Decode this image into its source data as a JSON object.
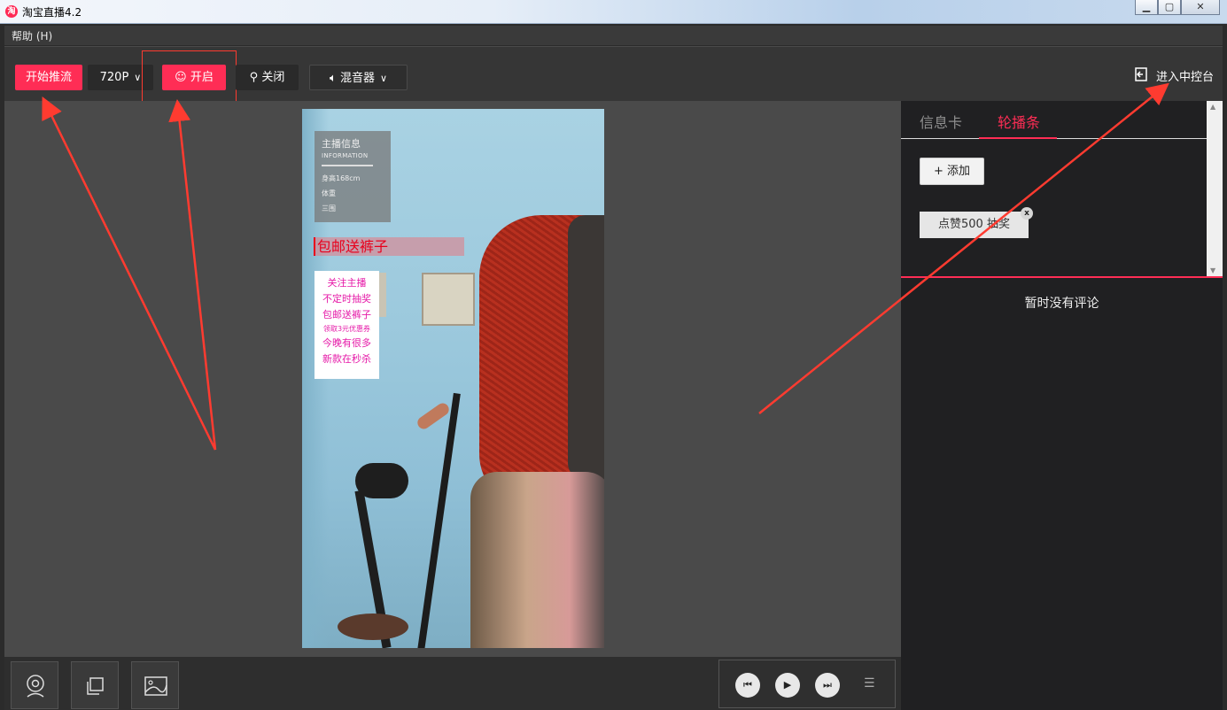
{
  "window": {
    "title": "淘宝直播4.2",
    "app_icon": "taobao-live-icon",
    "controls": [
      "minimize",
      "maximize",
      "close"
    ]
  },
  "menu": {
    "help": "帮助 (H)"
  },
  "toolbar": {
    "start_stream": "开始推流",
    "resolution": "720P",
    "beauty_on": "开启",
    "beauty_off": "关闭",
    "mixer": "混音器",
    "console": "进入中控台"
  },
  "preview": {
    "info_card": {
      "title": "主播信息",
      "subtitle": "INFORMATION",
      "height": "身高168cm",
      "weight": "体重",
      "other": "三围"
    },
    "banner": "包邮送裤子",
    "promo_list": [
      "关注主播",
      "不定时抽奖",
      "包邮送裤子",
      "领取3元优惠券",
      "今晚有很多",
      "新款在秒杀"
    ]
  },
  "side_panel": {
    "tabs": [
      "信息卡",
      "轮播条"
    ],
    "active_tab": 1,
    "add_button": "+ 添加",
    "items": [
      "点赞500 抽奖"
    ],
    "comments_empty": "暂时没有评论"
  },
  "colors": {
    "accent": "#ff2d55",
    "annotation": "#ff3b30"
  }
}
